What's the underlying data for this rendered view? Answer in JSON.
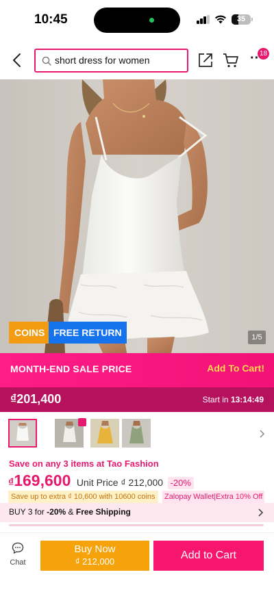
{
  "status_bar": {
    "time": "10:45",
    "battery": "35",
    "battery_level": 0.35
  },
  "header": {
    "search_query": "short dress for women",
    "cart_badge": "18",
    "more_glyph": "···"
  },
  "product": {
    "tags": {
      "coins": "COINS",
      "free_return": "FREE RETURN"
    },
    "image_counter": "1/5",
    "image_total": 5,
    "image_current": 1
  },
  "sale": {
    "title": "MONTH-END SALE PRICE",
    "cta": "Add To Cart!",
    "price": "₫201,400",
    "start_label": "Start in",
    "countdown": "13:14:49"
  },
  "price": {
    "promo": "Save on any 3 items at Tao Fashion",
    "currency": "₫",
    "amount": "169,600",
    "unit_price": "Unit Price ₫ 212,000",
    "discount": "-20%",
    "coins_promo": "Save up to extra ₫ 10,600 with 10600 coins",
    "wallet_promo": "Zalopay Wallet|Extra 10% Off"
  },
  "bundle": {
    "prefix": "BUY 3 for",
    "discount": "-20%",
    "joiner": "&",
    "shipping": "Free Shipping"
  },
  "bottom_bar": {
    "chat_label": "Chat",
    "buy_now_label": "Buy Now",
    "buy_now_price": "₫ 212,000",
    "add_to_cart_label": "Add to Cart"
  },
  "colors": {
    "brand_pink": "#e6196e",
    "coins_orange": "#f39c12",
    "return_blue": "#1673ee",
    "buy_now_orange": "#f6a20b"
  },
  "icons": [
    "back-icon",
    "search-icon",
    "share-icon",
    "cart-icon",
    "more-icon",
    "chevron-right-icon",
    "chat-icon"
  ]
}
